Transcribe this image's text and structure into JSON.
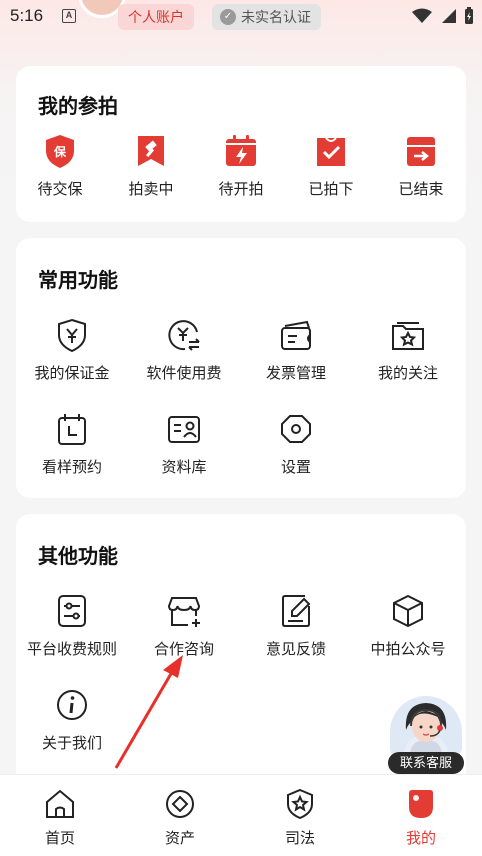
{
  "status": {
    "time": "5:16"
  },
  "header": {
    "account_badge": "个人账户",
    "verify_badge": "未实名认证"
  },
  "auctions": {
    "title": "我的参拍",
    "items": [
      {
        "label": "待交保",
        "icon": "deposit-shield-icon"
      },
      {
        "label": "拍卖中",
        "icon": "gavel-bookmark-icon"
      },
      {
        "label": "待开拍",
        "icon": "calendar-bolt-icon"
      },
      {
        "label": "已拍下",
        "icon": "check-bag-icon"
      },
      {
        "label": "已结束",
        "icon": "exit-box-icon"
      }
    ]
  },
  "common": {
    "title": "常用功能",
    "items": [
      {
        "label": "我的保证金",
        "icon": "yen-shield-icon"
      },
      {
        "label": "软件使用费",
        "icon": "yen-exchange-icon"
      },
      {
        "label": "发票管理",
        "icon": "invoice-icon"
      },
      {
        "label": "我的关注",
        "icon": "star-folder-icon"
      },
      {
        "label": "看样预约",
        "icon": "calendar-clock-icon"
      },
      {
        "label": "资料库",
        "icon": "id-card-icon"
      },
      {
        "label": "设置",
        "icon": "settings-hexagon-icon"
      }
    ]
  },
  "other": {
    "title": "其他功能",
    "items": [
      {
        "label": "平台收费规则",
        "icon": "sliders-doc-icon"
      },
      {
        "label": "合作咨询",
        "icon": "store-plus-icon"
      },
      {
        "label": "意见反馈",
        "icon": "edit-doc-icon"
      },
      {
        "label": "中拍公众号",
        "icon": "cube-icon"
      },
      {
        "label": "关于我们",
        "icon": "info-circle-icon"
      }
    ]
  },
  "customer_service": {
    "label": "联系客服"
  },
  "nav": {
    "items": [
      {
        "label": "首页",
        "icon": "home-icon"
      },
      {
        "label": "资产",
        "icon": "diamond-icon"
      },
      {
        "label": "司法",
        "icon": "star-shield-icon"
      },
      {
        "label": "我的",
        "icon": "profile-icon",
        "active": true
      }
    ],
    "active_color": "#e23c34"
  },
  "colors": {
    "accent": "#e23c34"
  }
}
